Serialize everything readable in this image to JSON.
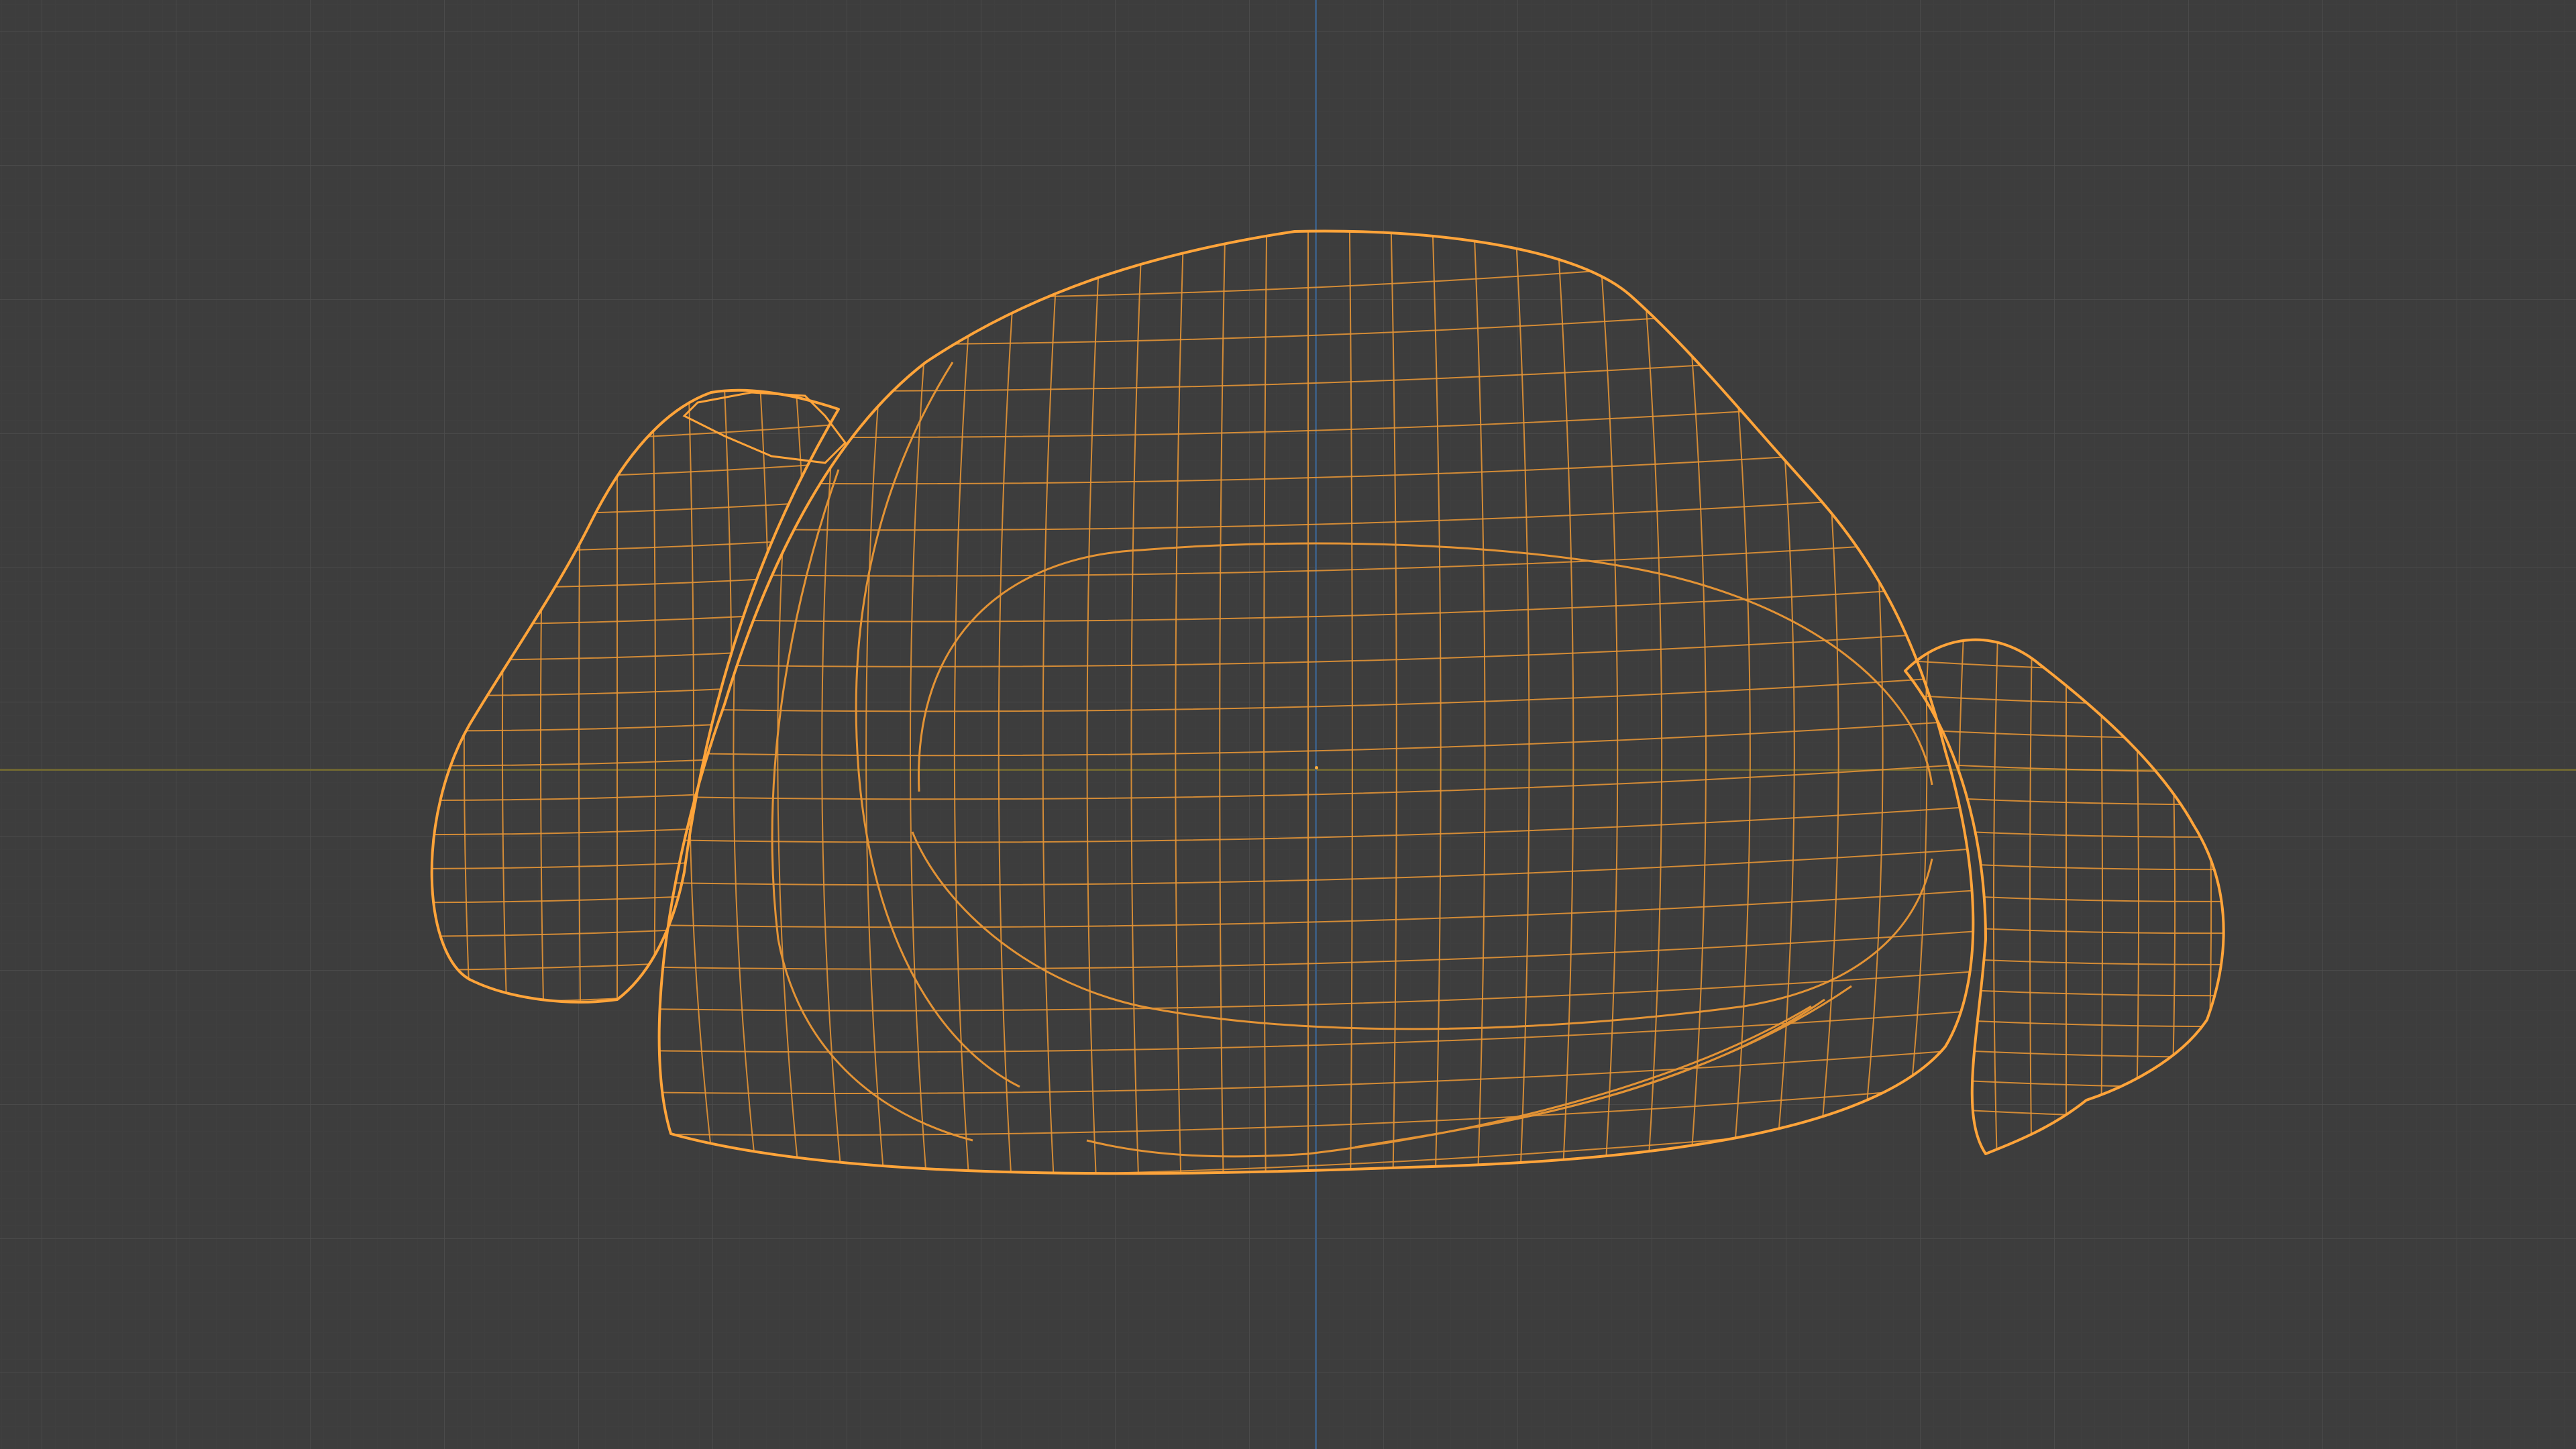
{
  "viewport": {
    "background": "#3d3d3d",
    "grid_major_color": "#4e4e4e",
    "grid_minor_color": "#404040",
    "axis_x_color": "#6f6732",
    "axis_y_color": "#3c5b7e"
  },
  "object": {
    "display": "wireframe",
    "selected": true,
    "wire_color": "#e39335",
    "outline_color": "#ffa43a"
  },
  "origin": {
    "icon": "object-origin-icon",
    "color": "#ffad3a"
  }
}
